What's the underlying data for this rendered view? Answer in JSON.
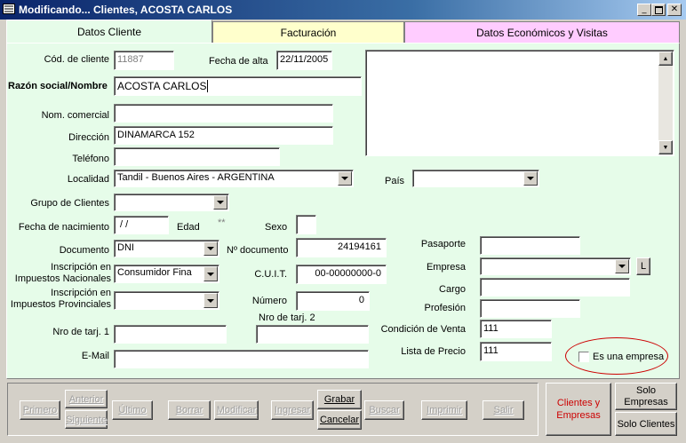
{
  "window": {
    "title": "Modificando... Clientes, ACOSTA CARLOS"
  },
  "tabs": [
    {
      "label": "Datos Cliente",
      "color": "#e6fce9"
    },
    {
      "label": "Facturación",
      "color": "#ffffcc"
    },
    {
      "label": "Datos Económicos y Visitas",
      "color": "#ffccff"
    }
  ],
  "form": {
    "cod_cliente": {
      "label": "Cód. de cliente",
      "value": "11887"
    },
    "fecha_alta": {
      "label": "Fecha de alta",
      "value": "22/11/2005"
    },
    "razon_social": {
      "label": "Razón social/Nombre",
      "value": "ACOSTA CARLOS"
    },
    "nom_comercial": {
      "label": "Nom. comercial",
      "value": ""
    },
    "direccion": {
      "label": "Dirección",
      "value": "DINAMARCA 152"
    },
    "telefono": {
      "label": "Teléfono",
      "value": ""
    },
    "localidad": {
      "label": "Localidad",
      "value": "Tandil - Buenos Aires - ARGENTINA"
    },
    "pais": {
      "label": "País",
      "value": ""
    },
    "grupo_clientes": {
      "label": "Grupo de Clientes",
      "value": ""
    },
    "fecha_nacimiento": {
      "label": "Fecha de nacimiento",
      "value": " / /"
    },
    "edad": {
      "label": "Edad",
      "value": "**"
    },
    "sexo": {
      "label": "Sexo",
      "value": ""
    },
    "documento": {
      "label": "Documento",
      "value": "DNI"
    },
    "nro_documento": {
      "label": "Nº documento",
      "value": "24194161"
    },
    "insc_nacionales": {
      "label_line1": "Inscripción en",
      "label_line2": "Impuestos Nacionales",
      "value": "Consumidor Fina"
    },
    "cuit": {
      "label": "C.U.I.T.",
      "value": "00-00000000-0"
    },
    "insc_provinciales": {
      "label_line1": "Inscripción en",
      "label_line2": "Impuestos Provinciales",
      "value": ""
    },
    "numero": {
      "label": "Número",
      "value": "0"
    },
    "nro_tarj1": {
      "label": "Nro de tarj. 1",
      "value": ""
    },
    "nro_tarj2": {
      "label": "Nro de tarj. 2",
      "value": ""
    },
    "email": {
      "label": "E-Mail",
      "value": ""
    },
    "pasaporte": {
      "label": "Pasaporte",
      "value": ""
    },
    "empresa": {
      "label": "Empresa",
      "value": "",
      "btn": "L"
    },
    "cargo": {
      "label": "Cargo",
      "value": ""
    },
    "profesion": {
      "label": "Profesión",
      "value": ""
    },
    "condicion_venta": {
      "label": "Condición de Venta",
      "value": "111"
    },
    "lista_precio": {
      "label": "Lista de Precio",
      "value": "111"
    },
    "es_empresa": {
      "label": "Es una empresa",
      "checked": false
    }
  },
  "toolbar": {
    "primero": "Primero",
    "anterior": "Anterior",
    "siguiente": "Siguiente",
    "ultimo": "Último",
    "borrar": "Borrar",
    "modificar": "Modificar",
    "ingresar": "Ingresar",
    "grabar": "Grabar",
    "cancelar": "Cancelar",
    "buscar": "Buscar",
    "imprimir": "Imprimir",
    "salir": "Salir"
  },
  "side": {
    "clientes_empresas": "Clientes y Empresas",
    "solo_empresas": "Solo Empresas",
    "solo_clientes": "Solo Clientes"
  },
  "colors": {
    "highlight_red": "#cc0000"
  }
}
